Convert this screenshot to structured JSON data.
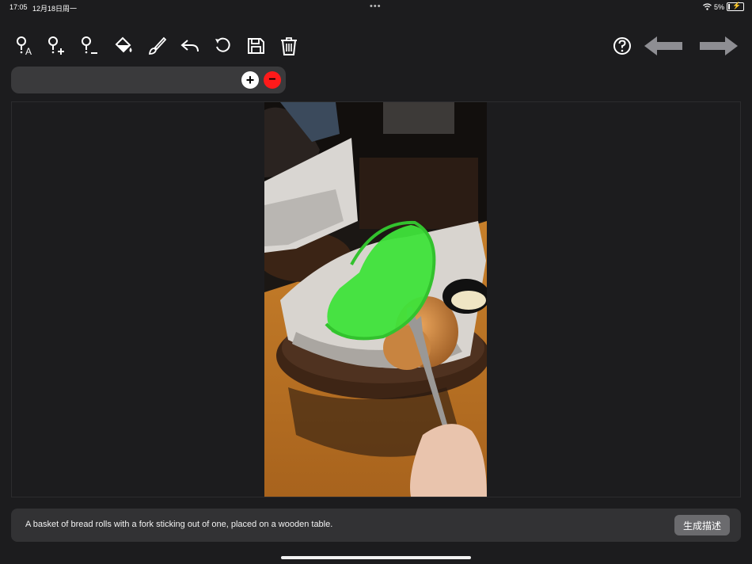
{
  "status": {
    "time": "17:05",
    "date": "12月18日周一",
    "battery": "5%"
  },
  "toolbar": {
    "tools": [
      "pin-a-icon",
      "pin-plus-icon",
      "pin-minus-icon",
      "paint-bucket-icon",
      "brush-icon",
      "undo-icon",
      "rotate-icon",
      "save-icon",
      "trash-icon"
    ],
    "help_icon": "help-icon",
    "back_arrow_icon": "arrow-left-icon",
    "forward_arrow_icon": "arrow-right-icon"
  },
  "tag_bar": {
    "add_label": "+",
    "remove_label": "−"
  },
  "caption": {
    "text": "A basket of bread rolls with a fork sticking out of one, placed on a wooden table.",
    "generate_label": "生成描述"
  },
  "colors": {
    "background": "#1c1c1e",
    "mask": "#3fe33a",
    "remove": "#ff1a1a"
  }
}
